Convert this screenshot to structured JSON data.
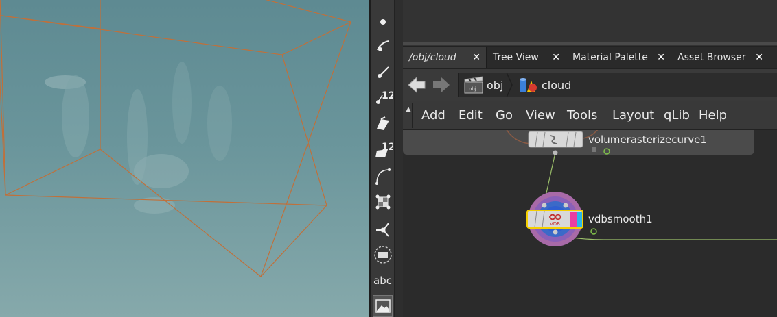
{
  "toolbar": {
    "tools": [
      {
        "name": "point-tool-icon",
        "label": ""
      },
      {
        "name": "curve-tool-icon",
        "label": ""
      },
      {
        "name": "draw-tool-icon",
        "label": ""
      },
      {
        "name": "edit-points-icon",
        "label": "12"
      },
      {
        "name": "poly-tool-icon",
        "label": ""
      },
      {
        "name": "edit-polys-icon",
        "label": "12"
      },
      {
        "name": "bezier-tool-icon",
        "label": ""
      },
      {
        "name": "transform-tool-icon",
        "label": ""
      },
      {
        "name": "handle-tool-icon",
        "label": ""
      },
      {
        "name": "circle-select-icon",
        "label": ""
      },
      {
        "name": "text-tool-icon",
        "label": "abc"
      },
      {
        "name": "image-tool-icon",
        "label": ""
      }
    ]
  },
  "tabs": [
    {
      "label": "/obj/cloud",
      "active": true
    },
    {
      "label": "Tree View",
      "active": false
    },
    {
      "label": "Material Palette",
      "active": false
    },
    {
      "label": "Asset Browser",
      "active": false
    }
  ],
  "close_glyph": "✕",
  "path": {
    "segments": [
      {
        "label": "obj",
        "icon": "obj-clapper-icon"
      },
      {
        "label": "cloud",
        "icon": "geometry-shapes-icon"
      }
    ]
  },
  "menu": [
    "Add",
    "Edit",
    "Go",
    "View",
    "Tools",
    "Layout",
    "qLib",
    "Help"
  ],
  "nodes": {
    "upstream": {
      "label": "volumerasterizecurve1"
    },
    "selected": {
      "label": "vdbsmooth1",
      "badge": "VDB"
    }
  },
  "colors": {
    "viewport_bg": "#6a959b",
    "bounding_box": "#c0703a",
    "node_selected_outline": "#f5d000",
    "wire": "#9bbf6a"
  }
}
